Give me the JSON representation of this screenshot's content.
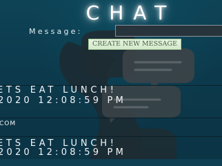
{
  "header": {
    "title": "CHAT"
  },
  "composer": {
    "label": "Message:",
    "input_value": "",
    "input_placeholder": "",
    "create_button_label": "CREATE NEW MESSAGE"
  },
  "messages": [
    {
      "text": "ETS EAT LUNCH!",
      "timestamp": "2020 12:08:59 PM",
      "sender": "COM"
    },
    {
      "text": "ETS EAT LUNCH!",
      "timestamp": "2020 12:08:59 PM"
    }
  ],
  "colors": {
    "background": "#0e3f52",
    "text": "#f3f6f8",
    "button_bg": "#d8ecd0",
    "button_text": "#476347",
    "input_bg": "#28343c"
  },
  "icons": {
    "background_art": "chat-bubbles-icon"
  }
}
